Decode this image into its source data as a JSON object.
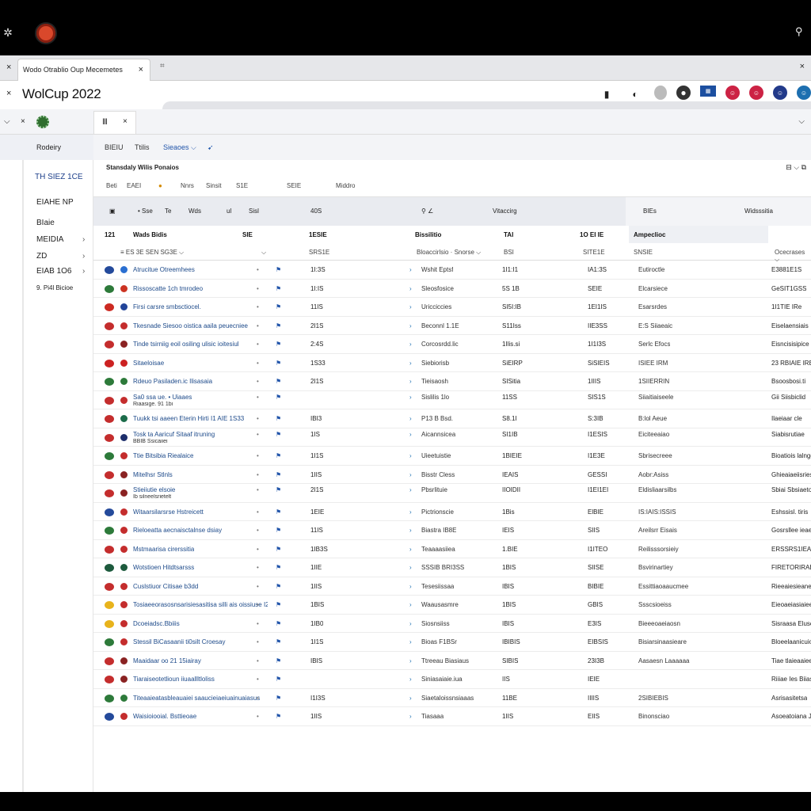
{
  "os": {
    "left_icon": "✲",
    "right_icon": "⚲"
  },
  "browser": {
    "tab_title": "Wodo Otrablio Oup Mecemetes",
    "tab_close": "×",
    "new_tab": "⌗",
    "window_close": "×",
    "left_x": "×"
  },
  "header": {
    "title": "WolCup 2022",
    "left_x": "×",
    "icons": [
      "▮",
      "◐",
      "◍",
      "●",
      "▦",
      "☺",
      "☺",
      "☺",
      "☺"
    ]
  },
  "subbar": {
    "chev": "⌵",
    "x": "×",
    "tab_label": "Ⅲ",
    "tab_close": "×",
    "right_icon": "⌵"
  },
  "sidebar": {
    "header": "Rodeiry",
    "items": [
      {
        "label": "TH SIEZ 1CE"
      },
      {
        "label": "EIAHE NP"
      },
      {
        "label": "BIaie"
      },
      {
        "label": "MEIDIA"
      },
      {
        "label": "ZD"
      },
      {
        "label": "EIAB 1O6"
      },
      {
        "label": "9. Pi4l Bicioe"
      }
    ]
  },
  "toolbar": {
    "items": [
      "BIEIU",
      "Ttilis",
      "Sieaoes ⌵"
    ]
  },
  "section": {
    "title": "Stansdaly Wilis Ponaios",
    "right": "⊟ ⌵ ⧉"
  },
  "filters": [
    "Beti",
    "EAEI",
    "Nnrs",
    "Sinsit",
    "S1E",
    "SEIE",
    "Middro"
  ],
  "panel_header": {
    "a": "▣",
    "b": "• Sse",
    "c": "Te",
    "d": "Wds",
    "e": "ul",
    "f": "Sisl",
    "g": "40S",
    "h": "⚲ ∠",
    "i": "Vitaccirg",
    "j": "BIEs",
    "k": "Widsssitia"
  },
  "columns": [
    "121",
    "Wads Bidis",
    "SIE",
    "1ESIE",
    "Bissilitio",
    "TAI",
    "1O EI IE",
    "Ampeclioc"
  ],
  "filter_row": [
    "≡ ES 3E SEN SG3E ⌵",
    "⌵",
    "SRS1E",
    "Bloaccirlsio · Snorse ⌵",
    "BSI",
    "SITE1E",
    "SNSIE",
    "Ocecrases ⌵"
  ],
  "rows": [
    {
      "team": "Atrucitue Otreemhees",
      "c1": "1I:3S",
      "c2": "Wshit Eptsf",
      "c3": "1I1:I1",
      "c4": "IA1:3S",
      "c5": "Eutiroctle",
      "c6": "E3881E1S",
      "flag": "#244a9b",
      "flag2": "#2a6fd1"
    },
    {
      "team": "Rissoscatte 1ch tmrodeo",
      "c1": "1I:IS",
      "c2": "Sleosfosice",
      "c3": "5S 1B",
      "c4": "SEIE",
      "c5": "Elcarsiece",
      "c6": "GeSIT1GSS",
      "flag": "#2d7a3a",
      "flag2": "#cc3322"
    },
    {
      "team": "Firsi carsre smbsctiocel.",
      "c1": "11IS",
      "c2": "Uricciccies",
      "c3": "SI5I:IB",
      "c4": "1EI1IS",
      "c5": "Esarsrdes",
      "c6": "1I1TIE IRe",
      "flag": "#cc2a22",
      "flag2": "#224499"
    },
    {
      "team": "Tkesnade Siesoo oistica aaila peuecniee",
      "c1": "2I1S",
      "c2": "Beconnl 1.1E",
      "c3": "S11Iss",
      "c4": "IIE3SS",
      "c5": "E:S Siiaeaic",
      "c6": "Eiselaensiais",
      "flag": "#c42d2d",
      "flag2": "#c42d2d"
    },
    {
      "team": "Tinde tsirniig eoil osiling ulisic ioitesiul",
      "c1": "2:4S",
      "c2": "Corcosrdd.lic",
      "c3": "1Ilis.si",
      "c4": "1I1I3S",
      "c5": "Serlc Efocs",
      "c6": "Eisncisisipice",
      "flag": "#c42d2d",
      "flag2": "#8a2222"
    },
    {
      "team": "Sitaeloisae",
      "c1": "1S33",
      "c2": "Siebiorisb",
      "c3": "SiEIRP",
      "c4": "SiSIEIS",
      "c5": "ISIEE IRM",
      "c6": "23 RBIAIE IRE",
      "flag": "#cc2222",
      "flag2": "#cc2222"
    },
    {
      "team": "Rdeuo Pasiladen.ic Ilisasaia",
      "c1": "2I1S",
      "c2": "Tieisaosh",
      "c3": "SISitia",
      "c4": "1IIIS",
      "c5": "1SIIERRIN",
      "c6": "Bsoosbosi.ti",
      "flag": "#2d7a3a",
      "flag2": "#2d7a3a"
    },
    {
      "team": "Sa0 ssa ue. • Uiaaes",
      "sub": "Riaasige. 91 1bi",
      "c1": "",
      "c2": "Sislilis 1lo",
      "c3": "11SS",
      "c4": "SIS1S",
      "c5": "Siiaitiaiseele",
      "c6": "Gii Siisbiclid",
      "flag": "#c42d2d",
      "flag2": "#c42d2d"
    },
    {
      "team": "Tuukk tsi aaeen Eterin Hirti I1 AIE 1S33",
      "c1": "IBI3",
      "c2": "P13 B Bsd.",
      "c3": "S8.1I",
      "c4": "S:3IB",
      "c5": "B:lol Aeue",
      "c6": "Ilaeiaar cle",
      "flag": "#c42d2d",
      "flag2": "#1c6c4a"
    },
    {
      "team": "Tosk ta Aaricuf Sitaaf itruning",
      "sub": "BBIB Ssicaiiei",
      "c1": "1IS",
      "c2": "Aicannsicea",
      "c3": "SI1IB",
      "c4": "I1ESIS",
      "c5": "Eiciteeaiao",
      "c6": "Siabisrutiae",
      "flag": "#c42d2d",
      "flag2": "#1d2e6b"
    },
    {
      "team": "Ttie Bitsibia Riealaice",
      "c1": "1I1S",
      "c2": "Uieetuistie",
      "c3": "1BIEIE",
      "c4": "I1E3E",
      "c5": "Sbrisecreee",
      "c6": "Bioatiois lalnggy",
      "flag": "#2d7a3a",
      "flag2": "#c42d2d"
    },
    {
      "team": "Mitelhsr Stlnls",
      "c1": "1IIS",
      "c2": "Bisstr Cless",
      "c3": "IEAIS",
      "c4": "GESSI",
      "c5": "Aobr:Asiss",
      "c6": "Ghieaiaeiisriesa",
      "flag": "#c42d2d",
      "flag2": "#8a2222"
    },
    {
      "team": "Stieiiutie elsoie",
      "sub": "Ib silneelsrietelt",
      "c1": "2I1S",
      "c2": "Pbsrlituie",
      "c3": "IIOIDII",
      "c4": "I1EI1EI",
      "c5": "Eldisliaarsilbs",
      "c6": "Sbiai Sbsiaetoo",
      "flag": "#c42d2d",
      "flag2": "#8a2222"
    },
    {
      "team": "Witaarsilarsrse Hstreicett",
      "c1": "1EIE",
      "c2": "Pictrionscie",
      "c3": "1Bis",
      "c4": "ElBIE",
      "c5": "IS:IAIS:ISSIS",
      "c6": "Eshssisl. tiris",
      "flag": "#244a9b",
      "flag2": "#c42d2d"
    },
    {
      "team": "Rieloeatta aecnaisctalnse dsiay",
      "c1": "11IS",
      "c2": "Biastra IB8E",
      "c3": "IEIS",
      "c4": "SIIS",
      "c5": "Areilsrr Eisais",
      "c6": "Gosrsllee ieaesse",
      "flag": "#2d7a3a",
      "flag2": "#c42d2d"
    },
    {
      "team": "Mstmaarisa cirerssitia",
      "c1": "1IB3S",
      "c2": "Teaaaasiiea",
      "c3": "1.BIE",
      "c4": "I1ITEO",
      "c5": "Reilisssorsieiy",
      "c6": "ERSSRS1IEAA.IS",
      "flag": "#c42d2d",
      "flag2": "#c42d2d"
    },
    {
      "team": "Wotstioen Hitdtsarsss",
      "c1": "1IIE",
      "c2": "SSSIB BRI3SS",
      "c3": "1BIS",
      "c4": "SIISE",
      "c5": "Bsvirinartiey",
      "c6": "FIRETORIRAEES",
      "flag": "#1d5a3d",
      "flag2": "#1d5a3d"
    },
    {
      "team": "Cuslstiuor Citisae b3dd",
      "c1": "1IIS",
      "c2": "Tesesiissaa",
      "c3": "IBIS",
      "c4": "BIBIE",
      "c5": "Essittiaoaaucmee",
      "c6": "Rieeaiesieanesu",
      "flag": "#c42d2d",
      "flag2": "#c42d2d"
    },
    {
      "team": "Tosiaeeorasosnsarisiesasitisa silli ais oissiuse I2",
      "c1": "1BIS",
      "c2": "Waausasmre",
      "c3": "1BIS",
      "c4": "GBIS",
      "c5": "Ssscsioeiss",
      "c6": "Eieoaeiasiaieeas",
      "flag": "#e8b31c",
      "flag2": "#c42d2d"
    },
    {
      "team": "Dcoeiadsc.Bbiiis",
      "c1": "1IB0",
      "c2": "Siosnsiiss",
      "c3": "IBIS",
      "c4": "E3IS",
      "c5": "Bieeeoaeiaosn",
      "c6": "Sisraasa Eluse",
      "flag": "#e8b31c",
      "flag2": "#c42d2d"
    },
    {
      "team": "Stessil BiCasaanii ti0silt Croesay",
      "c1": "1I1S",
      "c2": "Bioas F1BSr",
      "c3": "IBIBIS",
      "c4": "EIBSIS",
      "c5": "Bisiarsinaasieare",
      "c6": "Bloeelaanicuio",
      "flag": "#2d7a3a",
      "flag2": "#c42d2d"
    },
    {
      "team": "Maaidaar oo 21 15iairay",
      "c1": "IBIS",
      "c2": "Ttreeau Biasiaus",
      "c3": "SIBIS",
      "c4": "23I3B",
      "c5": "Aasaesn Laaaaaa",
      "c6": "Tiae tlaieaaieeoy",
      "flag": "#c42d2d",
      "flag2": "#8a2222"
    },
    {
      "team": "Tiaraiseotetlioun iiuaallltloliss",
      "c1": "",
      "c2": "Siniasaiaie.iua",
      "c3": "IIS",
      "c4": "IEIE",
      "c5": "",
      "c6": "Riiiae Ies Biiasaes",
      "flag": "#c42d2d",
      "flag2": "#8a2222"
    },
    {
      "team": "Titeaaieatasbleauaiei saaucieiaeiuainuaiasus",
      "c1": "I1I3S",
      "c2": "Siaetaloissnsiaaas",
      "c3": "11BE",
      "c4": "IIIIS",
      "c5": "2SIBIEBIS",
      "c6": "Asrisasitetsa",
      "flag": "#2d7a3a",
      "flag2": "#2d7a3a"
    },
    {
      "team": "Waisioiooial. Bsttieoae",
      "c1": "1IIS",
      "c2": "Tiasaaa",
      "c3": "1IIS",
      "c4": "EIIS",
      "c5": "Binonsciao",
      "c6": "Asoeatoiana Jla",
      "flag": "#244a9b",
      "flag2": "#c42d2d"
    }
  ]
}
